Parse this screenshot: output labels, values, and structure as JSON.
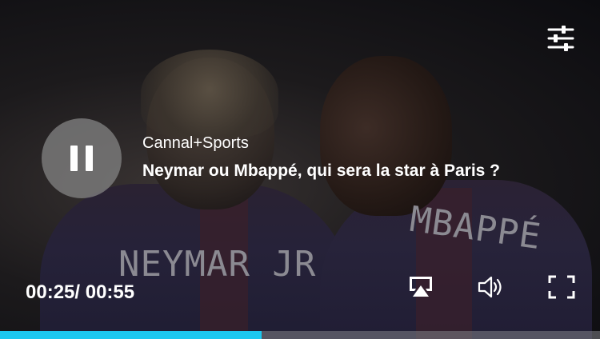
{
  "video": {
    "channel": "Cannal+Sports",
    "title": "Neymar ou Mbappé, qui sera la star à Paris ?",
    "jersey_left": "NEYMAR JR",
    "jersey_right": "MBAPPÉ"
  },
  "controls": {
    "current_time": "00:25/",
    "duration": "00:55",
    "progress_fraction": 0.4364,
    "progress_color": "#1cc8f0",
    "icons": [
      "pause-icon",
      "settings-sliders-icon",
      "airplay-icon",
      "volume-icon",
      "fullscreen-icon"
    ]
  }
}
